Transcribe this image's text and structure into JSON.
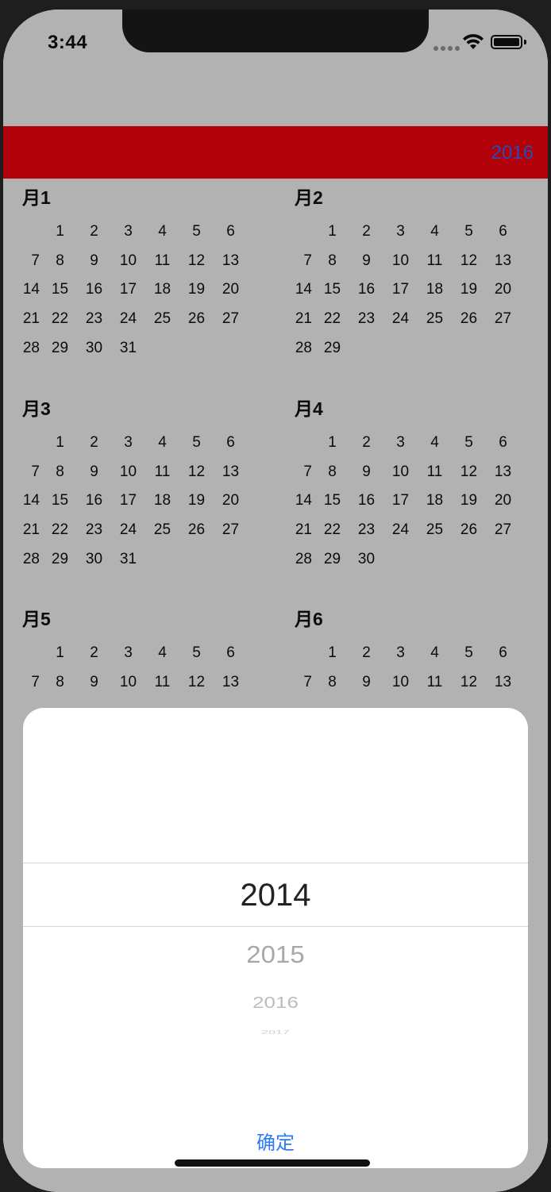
{
  "status_bar": {
    "time": "3:44"
  },
  "header": {
    "year": "2016",
    "background": "#ff0010",
    "year_color": "#3d6cff"
  },
  "calendar": {
    "months": [
      {
        "title": "月1",
        "weeks": [
          [
            "",
            "1",
            "2",
            "3",
            "4",
            "5",
            "6"
          ],
          [
            "7",
            "8",
            "9",
            "10",
            "11",
            "12",
            "13"
          ],
          [
            "14",
            "15",
            "16",
            "17",
            "18",
            "19",
            "20"
          ],
          [
            "21",
            "22",
            "23",
            "24",
            "25",
            "26",
            "27"
          ],
          [
            "28",
            "29",
            "30",
            "31",
            "",
            "",
            ""
          ]
        ]
      },
      {
        "title": "月2",
        "weeks": [
          [
            "",
            "1",
            "2",
            "3",
            "4",
            "5",
            "6"
          ],
          [
            "7",
            "8",
            "9",
            "10",
            "11",
            "12",
            "13"
          ],
          [
            "14",
            "15",
            "16",
            "17",
            "18",
            "19",
            "20"
          ],
          [
            "21",
            "22",
            "23",
            "24",
            "25",
            "26",
            "27"
          ],
          [
            "28",
            "29",
            "",
            "",
            "",
            "",
            ""
          ]
        ]
      },
      {
        "title": "月3",
        "weeks": [
          [
            "",
            "1",
            "2",
            "3",
            "4",
            "5",
            "6"
          ],
          [
            "7",
            "8",
            "9",
            "10",
            "11",
            "12",
            "13"
          ],
          [
            "14",
            "15",
            "16",
            "17",
            "18",
            "19",
            "20"
          ],
          [
            "21",
            "22",
            "23",
            "24",
            "25",
            "26",
            "27"
          ],
          [
            "28",
            "29",
            "30",
            "31",
            "",
            "",
            ""
          ]
        ]
      },
      {
        "title": "月4",
        "weeks": [
          [
            "",
            "1",
            "2",
            "3",
            "4",
            "5",
            "6"
          ],
          [
            "7",
            "8",
            "9",
            "10",
            "11",
            "12",
            "13"
          ],
          [
            "14",
            "15",
            "16",
            "17",
            "18",
            "19",
            "20"
          ],
          [
            "21",
            "22",
            "23",
            "24",
            "25",
            "26",
            "27"
          ],
          [
            "28",
            "29",
            "30",
            "",
            "",
            "",
            ""
          ]
        ]
      },
      {
        "title": "月5",
        "weeks": [
          [
            "",
            "1",
            "2",
            "3",
            "4",
            "5",
            "6"
          ],
          [
            "7",
            "8",
            "9",
            "10",
            "11",
            "12",
            "13"
          ]
        ]
      },
      {
        "title": "月6",
        "weeks": [
          [
            "",
            "1",
            "2",
            "3",
            "4",
            "5",
            "6"
          ],
          [
            "7",
            "8",
            "9",
            "10",
            "11",
            "12",
            "13"
          ]
        ]
      }
    ]
  },
  "picker": {
    "items": [
      "2014",
      "2015",
      "2016",
      "2017"
    ],
    "selected": "2014",
    "confirm_label": "确定",
    "confirm_color": "#2f7bf5"
  }
}
